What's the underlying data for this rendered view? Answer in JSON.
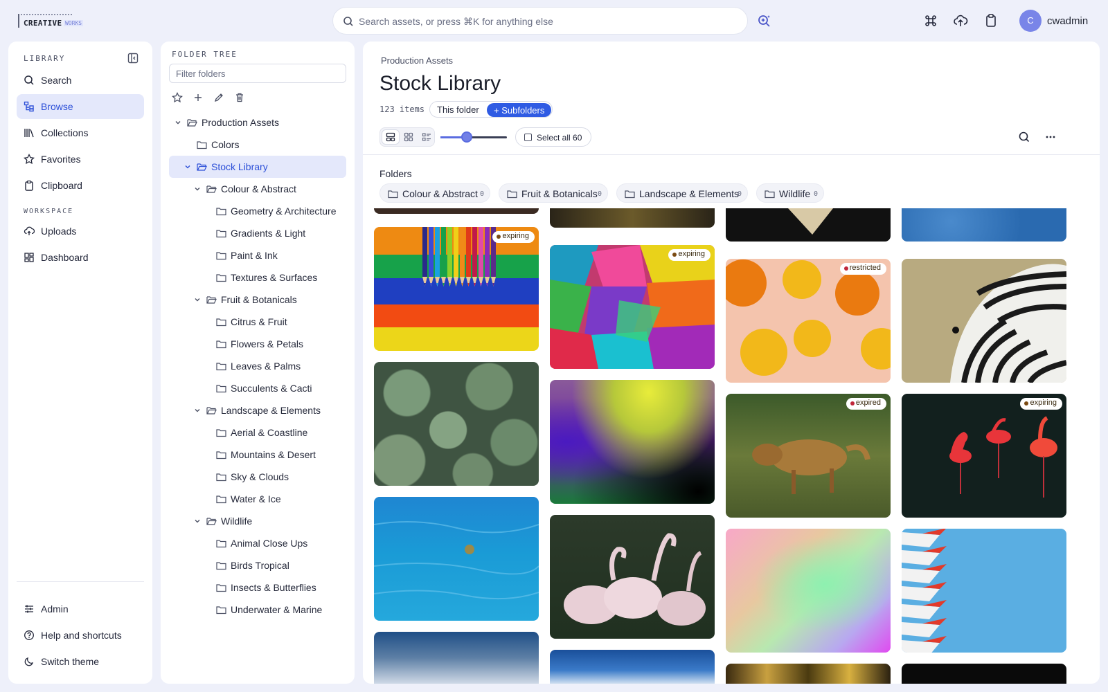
{
  "app": {
    "logo_main": "CREATIVE",
    "logo_sub": "WORKS"
  },
  "topbar": {
    "search_placeholder": "Search assets, or press ⌘K for anything else",
    "icons": [
      "ai-search-icon",
      "command-icon",
      "upload-icon",
      "clipboard-icon"
    ],
    "user_initial": "C",
    "user_name": "cwadmin"
  },
  "sidebar": {
    "library_label": "LIBRARY",
    "items": [
      {
        "label": "Search",
        "icon": "search-icon"
      },
      {
        "label": "Browse",
        "icon": "browse-icon",
        "active": true
      },
      {
        "label": "Collections",
        "icon": "collections-icon"
      },
      {
        "label": "Favorites",
        "icon": "star-icon"
      },
      {
        "label": "Clipboard",
        "icon": "clipboard-icon"
      }
    ],
    "workspace_label": "WORKSPACE",
    "workspace_items": [
      {
        "label": "Uploads",
        "icon": "upload-icon"
      },
      {
        "label": "Dashboard",
        "icon": "dashboard-icon"
      }
    ],
    "bottom_items": [
      {
        "label": "Admin",
        "icon": "sliders-icon"
      },
      {
        "label": "Help and shortcuts",
        "icon": "help-icon"
      },
      {
        "label": "Switch theme",
        "icon": "moon-icon"
      }
    ]
  },
  "folder_tree": {
    "title": "FOLDER TREE",
    "filter_placeholder": "Filter folders",
    "toolbar": [
      "star-icon",
      "plus-icon",
      "pencil-icon",
      "trash-icon"
    ],
    "nodes": [
      {
        "label": "Production Assets",
        "depth": 0,
        "expanded": true
      },
      {
        "label": "Colors",
        "depth": 1
      },
      {
        "label": "Stock Library",
        "depth": 1,
        "expanded": true,
        "selected": true
      },
      {
        "label": "Colour & Abstract",
        "depth": 2,
        "expanded": true
      },
      {
        "label": "Geometry & Architecture",
        "depth": 3
      },
      {
        "label": "Gradients & Light",
        "depth": 3
      },
      {
        "label": "Paint & Ink",
        "depth": 3
      },
      {
        "label": "Textures & Surfaces",
        "depth": 3
      },
      {
        "label": "Fruit & Botanicals",
        "depth": 2,
        "expanded": true
      },
      {
        "label": "Citrus & Fruit",
        "depth": 3
      },
      {
        "label": "Flowers & Petals",
        "depth": 3
      },
      {
        "label": "Leaves & Palms",
        "depth": 3
      },
      {
        "label": "Succulents & Cacti",
        "depth": 3
      },
      {
        "label": "Landscape & Elements",
        "depth": 2,
        "expanded": true
      },
      {
        "label": "Aerial & Coastline",
        "depth": 3
      },
      {
        "label": "Mountains & Desert",
        "depth": 3
      },
      {
        "label": "Sky & Clouds",
        "depth": 3
      },
      {
        "label": "Water & Ice",
        "depth": 3
      },
      {
        "label": "Wildlife",
        "depth": 2,
        "expanded": true
      },
      {
        "label": "Animal Close Ups",
        "depth": 3
      },
      {
        "label": "Birds Tropical",
        "depth": 3
      },
      {
        "label": "Insects & Butterflies",
        "depth": 3
      },
      {
        "label": "Underwater & Marine",
        "depth": 3
      }
    ]
  },
  "main": {
    "breadcrumb": "Production Assets",
    "title": "Stock Library",
    "item_count": "123 items",
    "scope_this": "This folder",
    "scope_sub": "+ Subfolders",
    "view_modes": [
      "masonry-view-icon",
      "grid-view-icon",
      "list-view-icon"
    ],
    "zoom_level": 0.4,
    "select_all": "Select all 60",
    "folders_heading": "Folders",
    "folders": [
      {
        "label": "Colour & Abstract",
        "count": "0"
      },
      {
        "label": "Fruit & Botanicals",
        "count": "0"
      },
      {
        "label": "Landscape & Elements",
        "count": "0"
      },
      {
        "label": "Wildlife",
        "count": "0"
      }
    ],
    "badges": {
      "expiring": "expiring",
      "restricted": "restricted",
      "expired": "expired"
    },
    "badge_colors": {
      "expiring": "#7a4a12",
      "restricted": "#c0263a",
      "expired": "#c0263a"
    }
  }
}
